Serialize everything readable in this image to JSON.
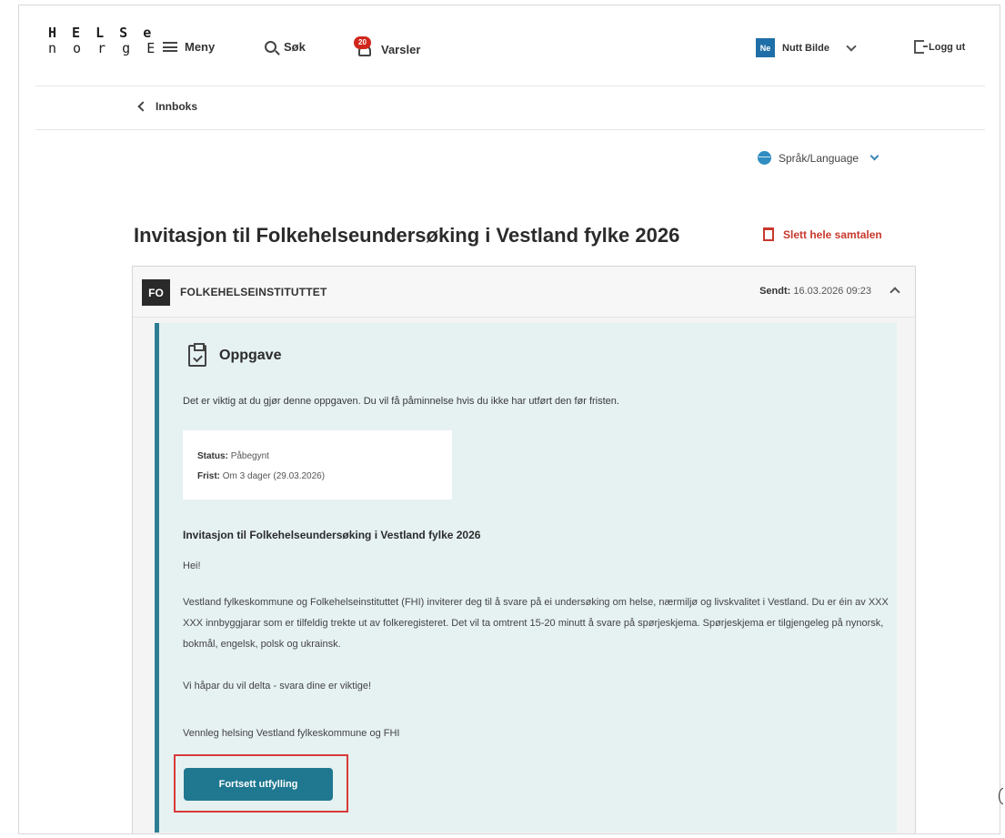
{
  "logo": {
    "line1": "H E L S e",
    "line2": "n o r g E"
  },
  "header": {
    "menu_label": "Meny",
    "search_label": "Søk",
    "alerts_label": "Varsler",
    "alerts_badge": "20",
    "user_initials": "Ne",
    "user_name": "Nutt Bilde",
    "logout_label": "Logg ut"
  },
  "breadcrumb": {
    "label": "Innboks"
  },
  "language": {
    "label": "Språk/Language"
  },
  "conversation": {
    "title": "Invitasjon til Folkehelseundersøking i Vestland fylke 2026",
    "delete_label": "Slett hele samtalen"
  },
  "message": {
    "sender_initials": "FO",
    "sender": "FOLKEHELSEINSTITUTTET",
    "sent_label": "Sendt:",
    "sent_value": "16.03.2026 09:23"
  },
  "task": {
    "title": "Oppgave",
    "description": "Det er viktig at du gjør denne oppgaven. Du vil få påminnelse hvis du ikke har utført den før fristen.",
    "status_label": "Status:",
    "status_value": "Påbegynt",
    "deadline_label": "Frist:",
    "deadline_value": "Om 3 dager (29.03.2026)",
    "message_title": "Invitasjon til Folkehelseundersøking i Vestland fylke 2026",
    "greeting": "Hei!",
    "body": "Vestland fylkeskommune og Folkehelseinstituttet (FHI) inviterer deg til å svare på ei undersøking om helse, nærmiljø og livskvalitet i Vestland. Du er éin av XXX XXX innbyggjarar som er tilfeldig trekte ut av folkeregisteret. Det vil ta omtrent 15-20 minutt å svare på spørjeskjema. Spørjeskjema er tilgjengeleg på nynorsk, bokmål, engelsk, polsk og ukrainsk.",
    "closing1": "Vi håpar du vil delta - svara dine er viktige!",
    "closing2": "Vennleg helsing Vestland fylkeskommune og FHI",
    "button_label": "Fortsett utfylling"
  },
  "colors": {
    "accent": "#1f7790",
    "task_bg": "#e6f1f2",
    "delete": "#c8392e",
    "highlight": "#d83a3a",
    "badge": "#d1261c"
  }
}
